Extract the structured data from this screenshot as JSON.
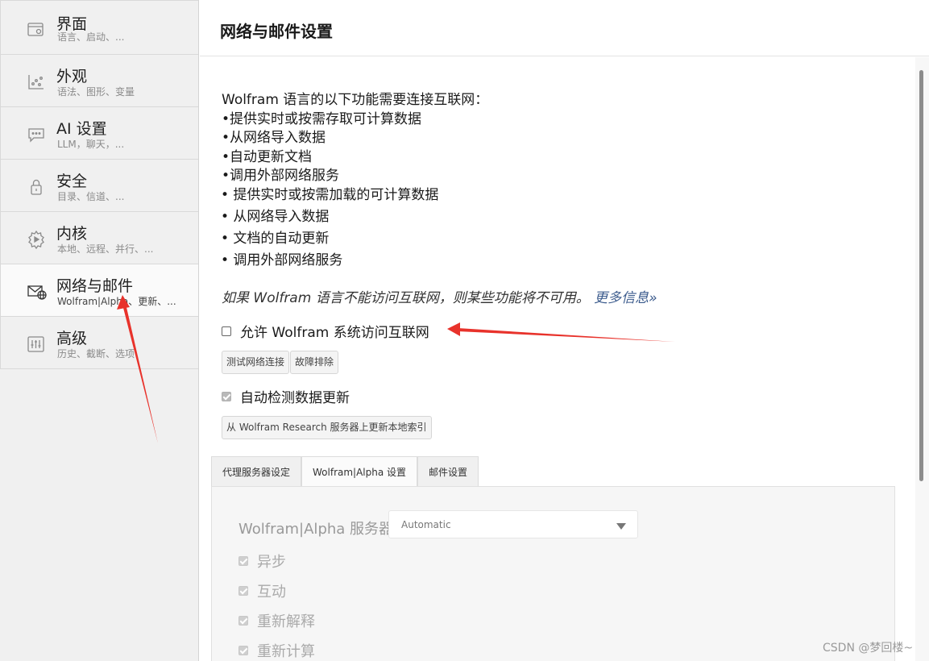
{
  "sidebar": {
    "items": [
      {
        "title": "界面",
        "sub": "语言、启动、...",
        "icon": "window-settings-icon"
      },
      {
        "title": "外观",
        "sub": "语法、图形、变量",
        "icon": "chart-appearance-icon"
      },
      {
        "title": "AI 设置",
        "sub": "LLM，聊天，...",
        "icon": "chat-bubble-icon"
      },
      {
        "title": "安全",
        "sub": "目录、信道、...",
        "icon": "lock-icon"
      },
      {
        "title": "内核",
        "sub": "本地、远程、并行、...",
        "icon": "kernel-gear-icon"
      },
      {
        "title": "网络与邮件",
        "sub": "Wolfram|Alpha、更新、...",
        "icon": "mail-globe-icon"
      },
      {
        "title": "高级",
        "sub": "历史、截断、选项",
        "icon": "sliders-icon"
      }
    ],
    "active_index": 5
  },
  "header": {
    "title": "网络与邮件设置"
  },
  "main": {
    "intro": "Wolfram 语言的以下功能需要连接互联网：",
    "list_a": [
      "•提供实时或按需存取可计算数据",
      "•从网络导入数据",
      "•自动更新文档",
      "•调用外部网络服务"
    ],
    "list_b": [
      "• 提供实时或按需加载的可计算数据",
      "• 从网络导入数据",
      "• 文档的自动更新",
      "• 调用外部网络服务"
    ],
    "note": "如果 Wolfram 语言不能访问互联网，则某些功能将不可用。",
    "note_link": "更多信息»",
    "allow_internet_label": "允许 Wolfram 系统访问互联网",
    "allow_internet_checked": false,
    "test_button": "测试网络连接",
    "troubleshoot_button": "故障排除",
    "auto_check_label": "自动检测数据更新",
    "auto_check_checked": true,
    "update_index_button": "从 Wolfram Research 服务器上更新本地索引"
  },
  "tabs": {
    "items": [
      "代理服务器设定",
      "Wolfram|Alpha 设置",
      "邮件设置"
    ],
    "active_index": 1
  },
  "wolfram_alpha": {
    "server_label": "Wolfram|Alpha 服务器",
    "server_value": "Automatic",
    "options": [
      {
        "label": "异步",
        "checked": true
      },
      {
        "label": "互动",
        "checked": true
      },
      {
        "label": "重新解释",
        "checked": true
      },
      {
        "label": "重新计算",
        "checked": true
      }
    ]
  },
  "watermark": "CSDN @梦回楼~",
  "colors": {
    "annotation_arrow": "#e8322b",
    "link": "#3a5a8c"
  }
}
